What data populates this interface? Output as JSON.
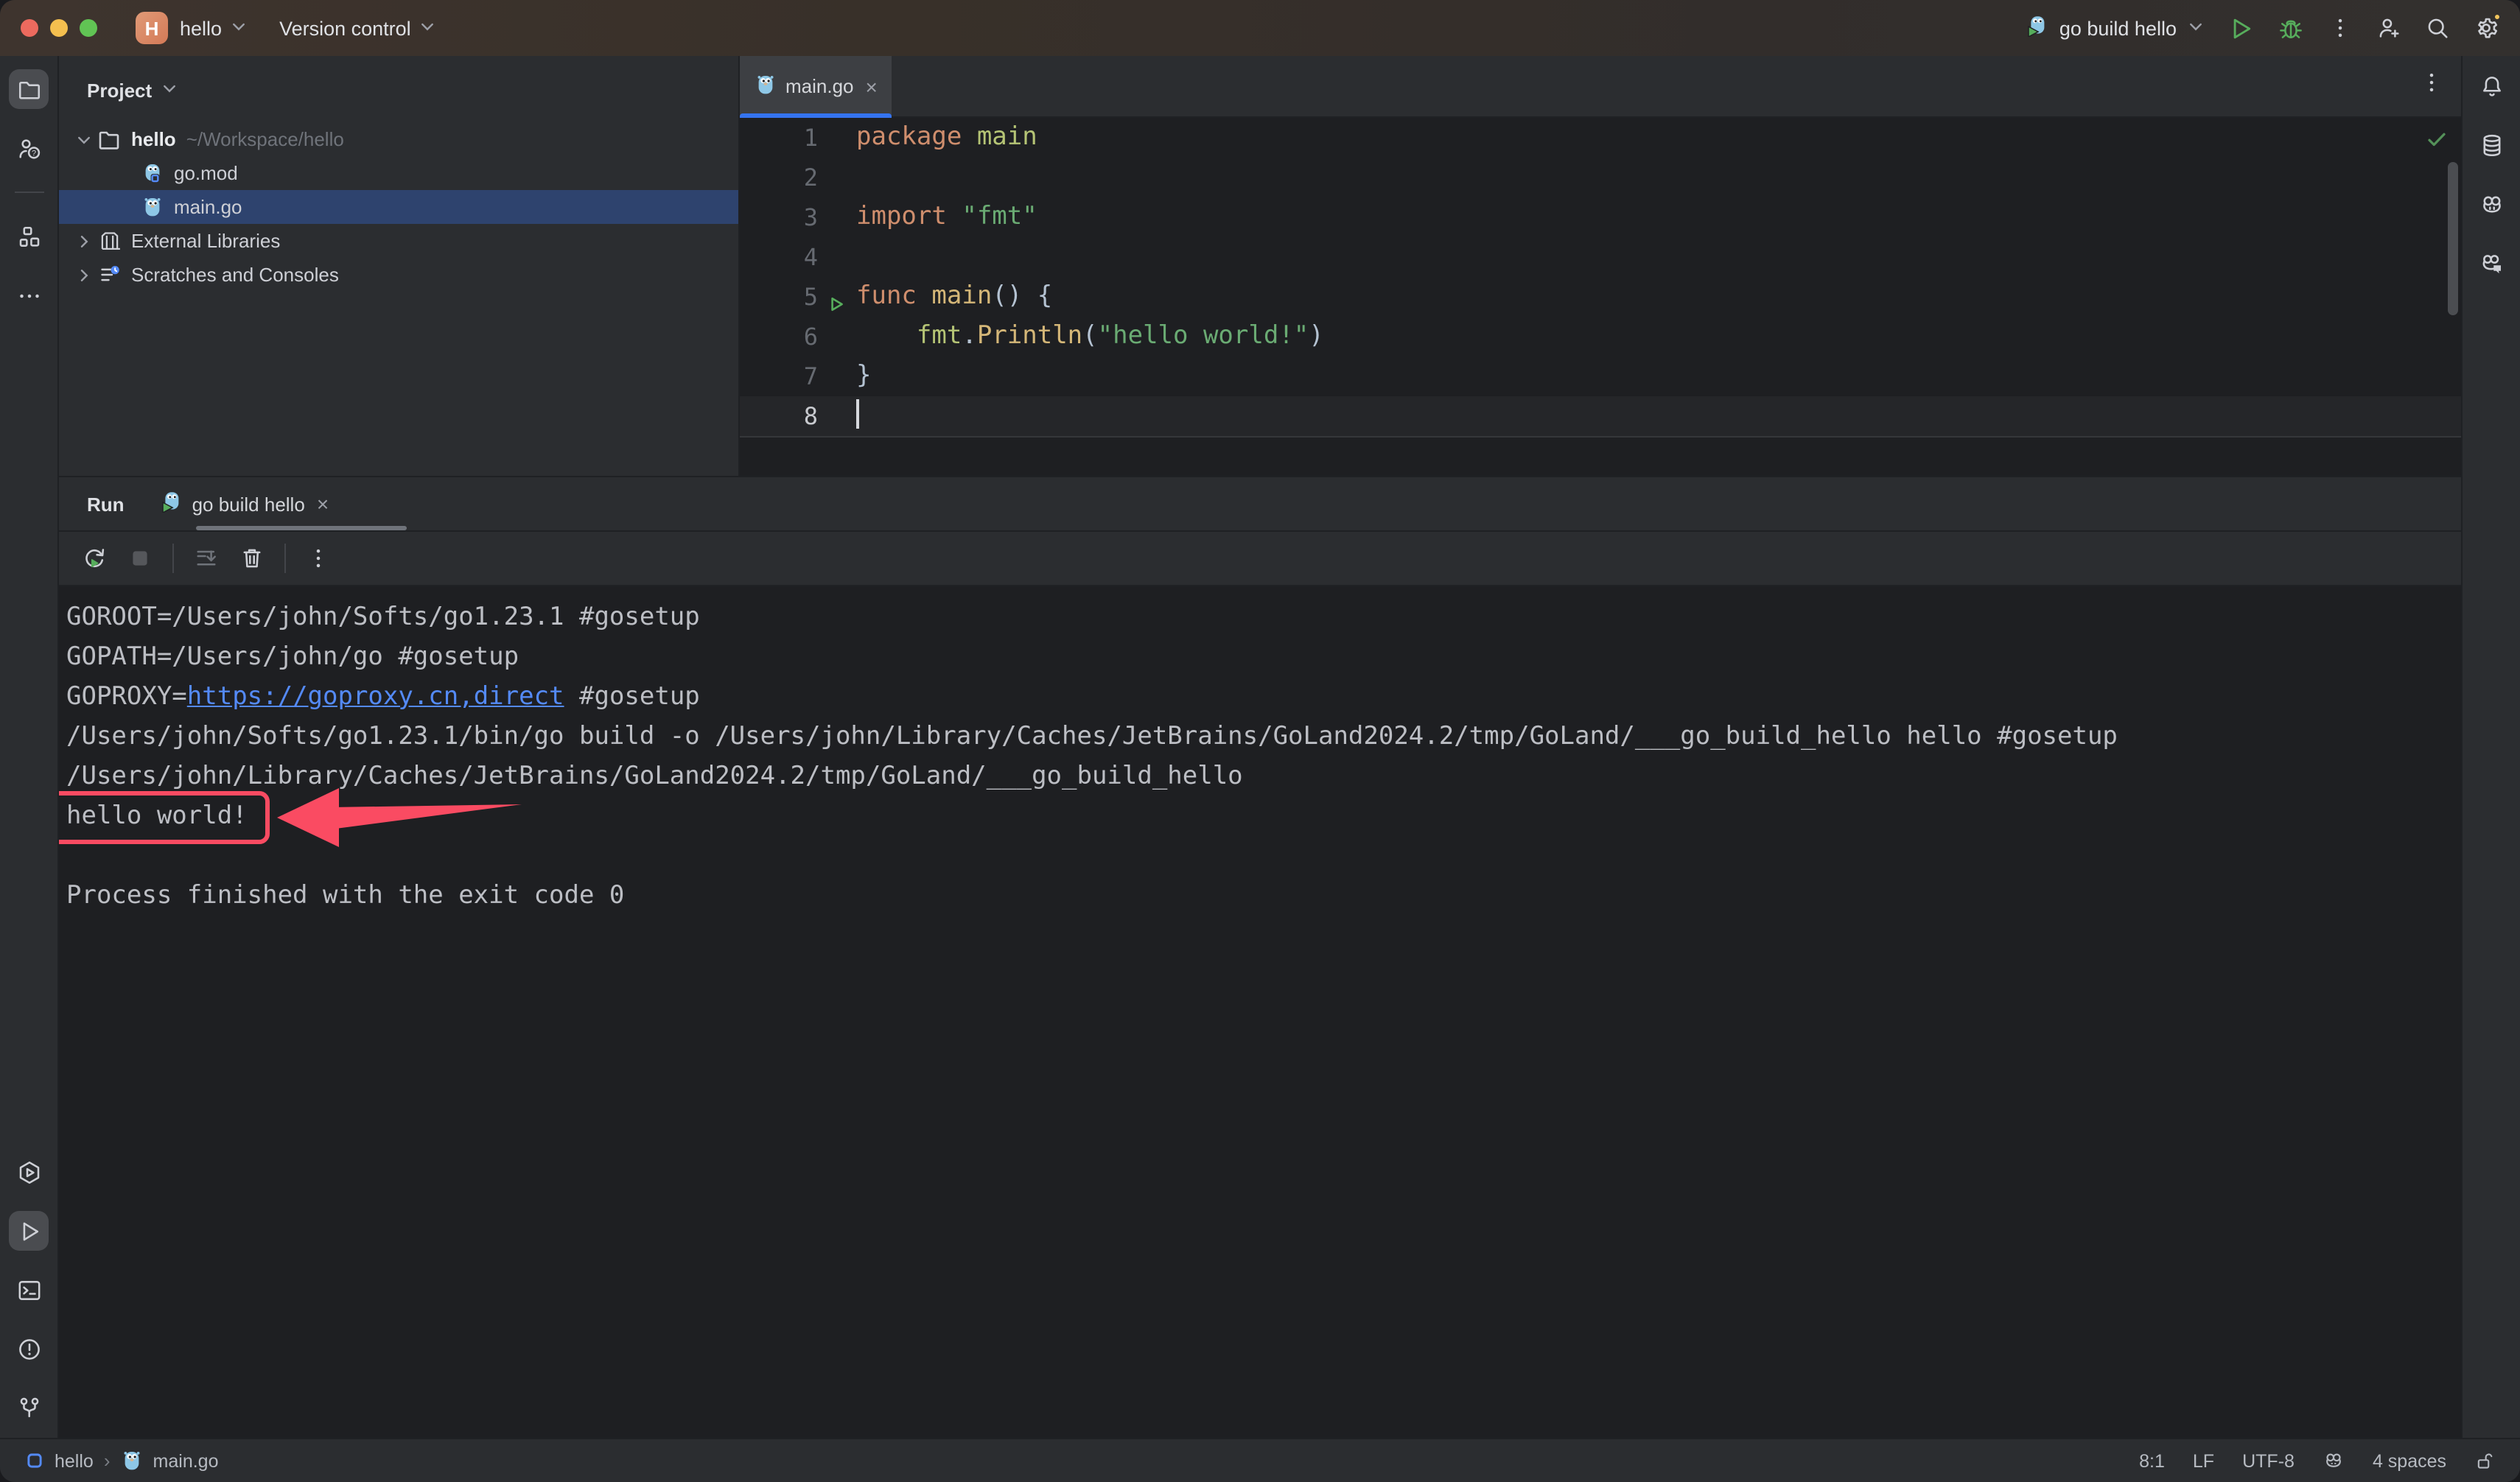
{
  "titlebar": {
    "project_badge": "H",
    "project_name": "hello",
    "vcs_menu": "Version control",
    "run_config": "go build hello",
    "right_icons": [
      "run-play",
      "debug-bug",
      "kebab",
      "person-plus",
      "search",
      "gear"
    ]
  },
  "left_stripe": {
    "top": [
      {
        "icon": "project-folder",
        "selected": true
      },
      {
        "icon": "pull-requests"
      },
      {
        "divider": true
      },
      {
        "icon": "structure"
      },
      {
        "icon": "more-tools"
      }
    ],
    "bottom": [
      {
        "icon": "services"
      },
      {
        "icon": "run",
        "selected": true
      },
      {
        "icon": "terminal"
      },
      {
        "icon": "problems"
      },
      {
        "icon": "git-branch"
      }
    ]
  },
  "right_stripe": {
    "top": [
      {
        "icon": "notifications-bell"
      },
      {
        "icon": "database"
      },
      {
        "icon": "gopher-tool"
      },
      {
        "icon": "gopher-chat"
      }
    ]
  },
  "project_panel": {
    "header": "Project",
    "tree": [
      {
        "icon": "folder",
        "label": "hello",
        "path": "~/Workspace/hello",
        "chevron": "expanded",
        "indent": 0,
        "bold": true
      },
      {
        "icon": "go-mod",
        "label": "go.mod",
        "indent": 1
      },
      {
        "icon": "go-file",
        "label": "main.go",
        "indent": 1,
        "selected": true
      },
      {
        "icon": "libraries",
        "label": "External Libraries",
        "chevron": "collapsed",
        "indent": 0
      },
      {
        "icon": "scratches",
        "label": "Scratches and Consoles",
        "chevron": "collapsed",
        "indent": 0
      }
    ]
  },
  "editor": {
    "tab": {
      "icon": "go-file",
      "label": "main.go",
      "close": "×"
    },
    "run_line": 5,
    "caret_line": 8,
    "lines": [
      {
        "num": 1,
        "tokens": [
          [
            "kw",
            "package"
          ],
          [
            "pln",
            " "
          ],
          [
            "pkg",
            "main"
          ]
        ]
      },
      {
        "num": 2,
        "tokens": []
      },
      {
        "num": 3,
        "tokens": [
          [
            "kw",
            "import"
          ],
          [
            "pln",
            " "
          ],
          [
            "str",
            "\"fmt\""
          ]
        ]
      },
      {
        "num": 4,
        "tokens": []
      },
      {
        "num": 5,
        "tokens": [
          [
            "kw",
            "func"
          ],
          [
            "pln",
            " "
          ],
          [
            "fn",
            "main"
          ],
          [
            "pun",
            "()"
          ],
          [
            "pln",
            " "
          ],
          [
            "pun",
            "{"
          ]
        ]
      },
      {
        "num": 6,
        "tokens": [
          [
            "pln",
            "    "
          ],
          [
            "pkg",
            "fmt"
          ],
          [
            "pun",
            "."
          ],
          [
            "fn",
            "Println"
          ],
          [
            "pun",
            "("
          ],
          [
            "str",
            "\"hello world!\""
          ],
          [
            "pun",
            ")"
          ]
        ]
      },
      {
        "num": 7,
        "tokens": [
          [
            "pun",
            "}"
          ]
        ]
      },
      {
        "num": 8,
        "tokens": []
      }
    ]
  },
  "run_panel": {
    "title": "Run",
    "tab": {
      "icon": "go-run",
      "label": "go build hello",
      "close": "×"
    },
    "toolbar": [
      {
        "icon": "rerun"
      },
      {
        "icon": "stop",
        "dim": true
      },
      {
        "divider": true
      },
      {
        "icon": "scroll-to-end",
        "dim": true
      },
      {
        "icon": "clear-all"
      },
      {
        "divider": true
      },
      {
        "icon": "kebab"
      }
    ]
  },
  "console": {
    "lines": [
      {
        "segments": [
          [
            "pln",
            "GOROOT=/Users/john/Softs/go1.23.1 #gosetup"
          ]
        ]
      },
      {
        "segments": [
          [
            "pln",
            "GOPATH=/Users/john/go #gosetup"
          ]
        ]
      },
      {
        "segments": [
          [
            "pln",
            "GOPROXY="
          ],
          [
            "link",
            "https://goproxy.cn,direct"
          ],
          [
            "pln",
            " #gosetup"
          ]
        ]
      },
      {
        "segments": [
          [
            "pln",
            "/Users/john/Softs/go1.23.1/bin/go build -o /Users/john/Library/Caches/JetBrains/GoLand2024.2/tmp/GoLand/___go_build_hello hello #gosetup"
          ]
        ]
      },
      {
        "segments": [
          [
            "pln",
            "/Users/john/Library/Caches/JetBrains/GoLand2024.2/tmp/GoLand/___go_build_hello"
          ]
        ]
      },
      {
        "segments": [
          [
            "pln",
            "hello world!"
          ]
        ],
        "highlight": true
      },
      {
        "segments": []
      },
      {
        "segments": [
          [
            "pln",
            "Process finished with the exit code 0"
          ]
        ]
      }
    ]
  },
  "annotation": {
    "color": "#fa4b62",
    "highlighted_text": "hello world!"
  },
  "status_bar": {
    "breadcrumb": [
      {
        "icon": "project-square",
        "label": "hello"
      },
      {
        "icon": "go-file",
        "label": "main.go"
      }
    ],
    "right": [
      {
        "label": "8:1"
      },
      {
        "label": "LF"
      },
      {
        "label": "UTF-8"
      },
      {
        "icon": "gopher-small"
      },
      {
        "label": "4 spaces"
      },
      {
        "icon": "lock-open"
      }
    ]
  },
  "colors": {
    "accent_blue": "#3574f0",
    "selection_blue": "#2e436e",
    "link_blue": "#548af7",
    "run_green": "#57ad5c",
    "check_green": "#549159",
    "annotation_red": "#fa4b62",
    "editor_bg": "#1e1f22",
    "chrome_bg": "#2b2d30",
    "kw_orange": "#cf8e6d",
    "str_green": "#6aab73",
    "fn_yellow": "#d5b778",
    "pkg_green": "#b5c475"
  }
}
